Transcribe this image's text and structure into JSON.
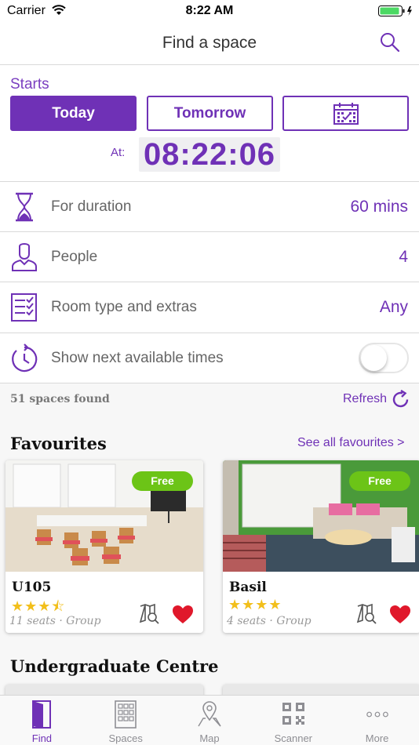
{
  "status_bar": {
    "carrier": "Carrier",
    "time": "8:22 AM"
  },
  "nav": {
    "title": "Find a space",
    "search_icon": "search-icon"
  },
  "starts": {
    "label": "Starts",
    "options": [
      "Today",
      "Tomorrow"
    ],
    "selected": "Today",
    "calendar_icon": "calendar-icon",
    "at_label": "At:",
    "time": "08:22:06"
  },
  "filters": [
    {
      "icon": "hourglass-icon",
      "label": "For duration",
      "value": "60 mins"
    },
    {
      "icon": "person-icon",
      "label": "People",
      "value": "4"
    },
    {
      "icon": "checklist-icon",
      "label": "Room type and extras",
      "value": "Any"
    },
    {
      "icon": "clock-refresh-icon",
      "label": "Show next available times",
      "toggle_on": false
    }
  ],
  "results": {
    "found": "51 spaces found",
    "refresh_label": "Refresh"
  },
  "favourites": {
    "title": "Favourites",
    "see_all": "See all favourites >",
    "cards": [
      {
        "name": "U105",
        "badge": "Free",
        "stars": "★★★⯪",
        "meta": "11 seats · Group"
      },
      {
        "name": "Basil",
        "badge": "Free",
        "stars": "★★★★",
        "meta": "4 seats · Group"
      }
    ]
  },
  "undergrad": {
    "title": "Undergraduate Centre"
  },
  "colors": {
    "accent": "#6f31b6",
    "badge_green": "#6cc417",
    "heart_red": "#e0182b",
    "star_yellow": "#f2bf1b"
  },
  "tabs": [
    {
      "label": "Find",
      "icon": "door-icon",
      "active": true
    },
    {
      "label": "Spaces",
      "icon": "building-icon",
      "active": false
    },
    {
      "label": "Map",
      "icon": "map-pin-icon",
      "active": false
    },
    {
      "label": "Scanner",
      "icon": "qr-code-icon",
      "active": false
    },
    {
      "label": "More",
      "icon": "more-dots-icon",
      "active": false
    }
  ]
}
